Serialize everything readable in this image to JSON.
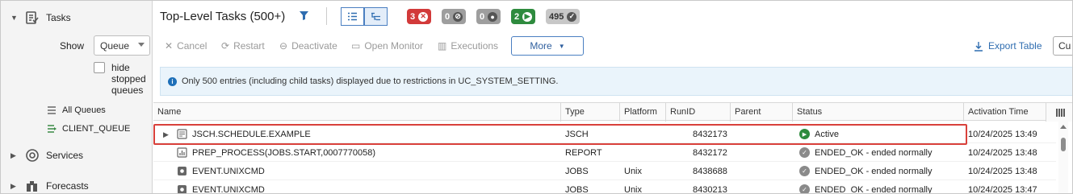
{
  "sidebar": {
    "tasks_label": "Tasks",
    "show_label": "Show",
    "show_select_value": "Queue",
    "hide_stopped_label": "hide stopped queues",
    "all_queues_label": "All Queues",
    "client_queue_label": "CLIENT_QUEUE",
    "services_label": "Services",
    "forecasts_label": "Forecasts"
  },
  "header": {
    "title": "Top-Level Tasks (500+)",
    "badges": [
      {
        "count": "3",
        "color": "#d23a3a",
        "icon": "error-x-icon"
      },
      {
        "count": "0",
        "color": "#9e9e9e",
        "icon": "blocked-icon"
      },
      {
        "count": "0",
        "color": "#9e9e9e",
        "icon": "waiting-icon"
      },
      {
        "count": "2",
        "color": "#2e8b3e",
        "icon": "play-icon"
      },
      {
        "count": "495",
        "color": "#c7c7c7",
        "icon": "check-icon"
      }
    ]
  },
  "toolbar": {
    "cancel": "Cancel",
    "restart": "Restart",
    "deactivate": "Deactivate",
    "open_monitor": "Open Monitor",
    "executions": "Executions",
    "more": "More",
    "export_table": "Export Table",
    "cu_button": "Cu"
  },
  "notice": "Only 500 entries (including child tasks) displayed due to restrictions in UC_SYSTEM_SETTING.",
  "table": {
    "headers": [
      "Name",
      "Type",
      "Platform",
      "RunID",
      "Parent",
      "Status",
      "Activation Time"
    ],
    "rows": [
      {
        "name": "JSCH.SCHEDULE.EXAMPLE",
        "type": "JSCH",
        "platform": "",
        "runid": "8432173",
        "parent": "",
        "status": "Active",
        "status_kind": "active",
        "time": "10/24/2025 13:49",
        "expandable": true
      },
      {
        "name": "PREP_PROCESS(JOBS.START,0007770058)",
        "type": "REPORT",
        "platform": "",
        "runid": "8432172",
        "parent": "",
        "status": "ENDED_OK - ended normally",
        "status_kind": "ok",
        "time": "10/24/2025 13:48",
        "expandable": false
      },
      {
        "name": "EVENT.UNIXCMD",
        "type": "JOBS",
        "platform": "Unix",
        "runid": "8438688",
        "parent": "",
        "status": "ENDED_OK - ended normally",
        "status_kind": "ok",
        "time": "10/24/2025 13:48",
        "expandable": false
      },
      {
        "name": "EVENT.UNIXCMD",
        "type": "JOBS",
        "platform": "Unix",
        "runid": "8430213",
        "parent": "",
        "status": "ENDED_OK - ended normally",
        "status_kind": "ok",
        "time": "10/24/2025 13:47",
        "expandable": false
      }
    ]
  },
  "colors": {
    "accent": "#2f6db0",
    "highlight": "#d9413b",
    "active_green": "#2e8b3e",
    "ok_grey": "#8a8a8a"
  }
}
